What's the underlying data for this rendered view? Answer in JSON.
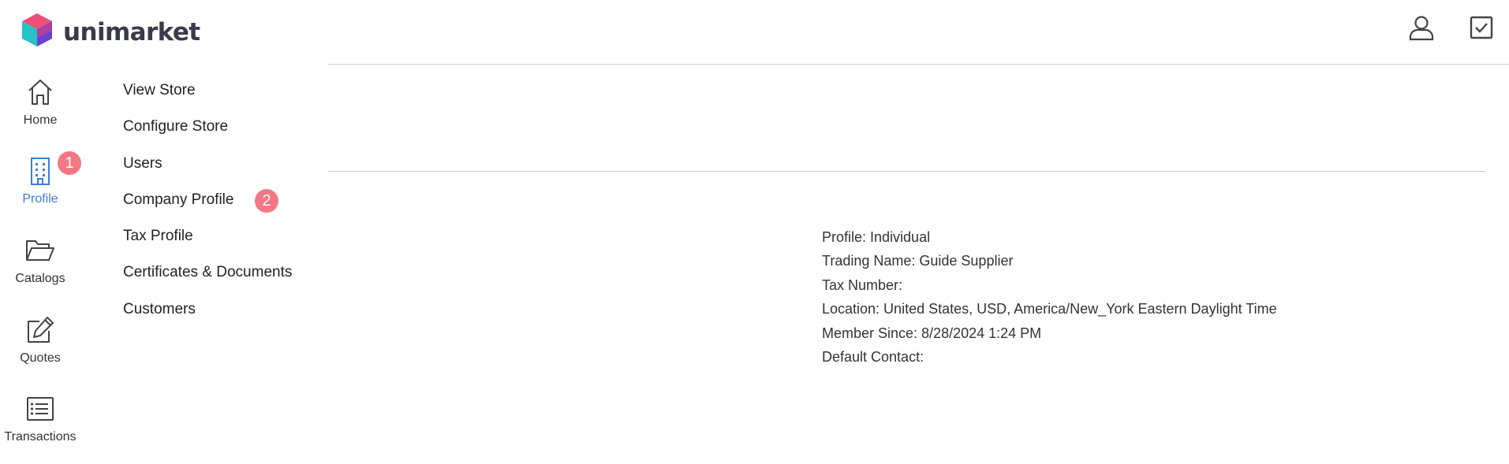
{
  "brand": {
    "name": "unimarket",
    "colors": {
      "pink": "#ef4f7b",
      "teal": "#22c4c8",
      "purple": "#6e3fd2",
      "accent": "#3b7dd8",
      "badge": "#f47884"
    }
  },
  "header": {
    "icons": [
      "user-icon",
      "checkbox-icon"
    ]
  },
  "rail": {
    "items": [
      {
        "label": "Home",
        "icon": "home-icon"
      },
      {
        "label": "Profile",
        "icon": "building-icon",
        "active": true
      },
      {
        "label": "Catalogs",
        "icon": "folder-icon"
      },
      {
        "label": "Quotes",
        "icon": "edit-icon"
      },
      {
        "label": "Transactions",
        "icon": "list-icon"
      }
    ]
  },
  "badges": {
    "first": "1",
    "second": "2"
  },
  "submenu": {
    "items": [
      "View Store",
      "Configure Store",
      "Users",
      "Company Profile",
      "Tax Profile",
      "Certificates & Documents",
      "Customers"
    ]
  },
  "details": {
    "lines": [
      "Profile: Individual",
      "Trading Name: Guide Supplier",
      "Tax Number:",
      "Location: United States, USD, America/New_York Eastern Daylight Time",
      "Member Since: 8/28/2024 1:24 PM",
      "Default Contact:"
    ]
  }
}
